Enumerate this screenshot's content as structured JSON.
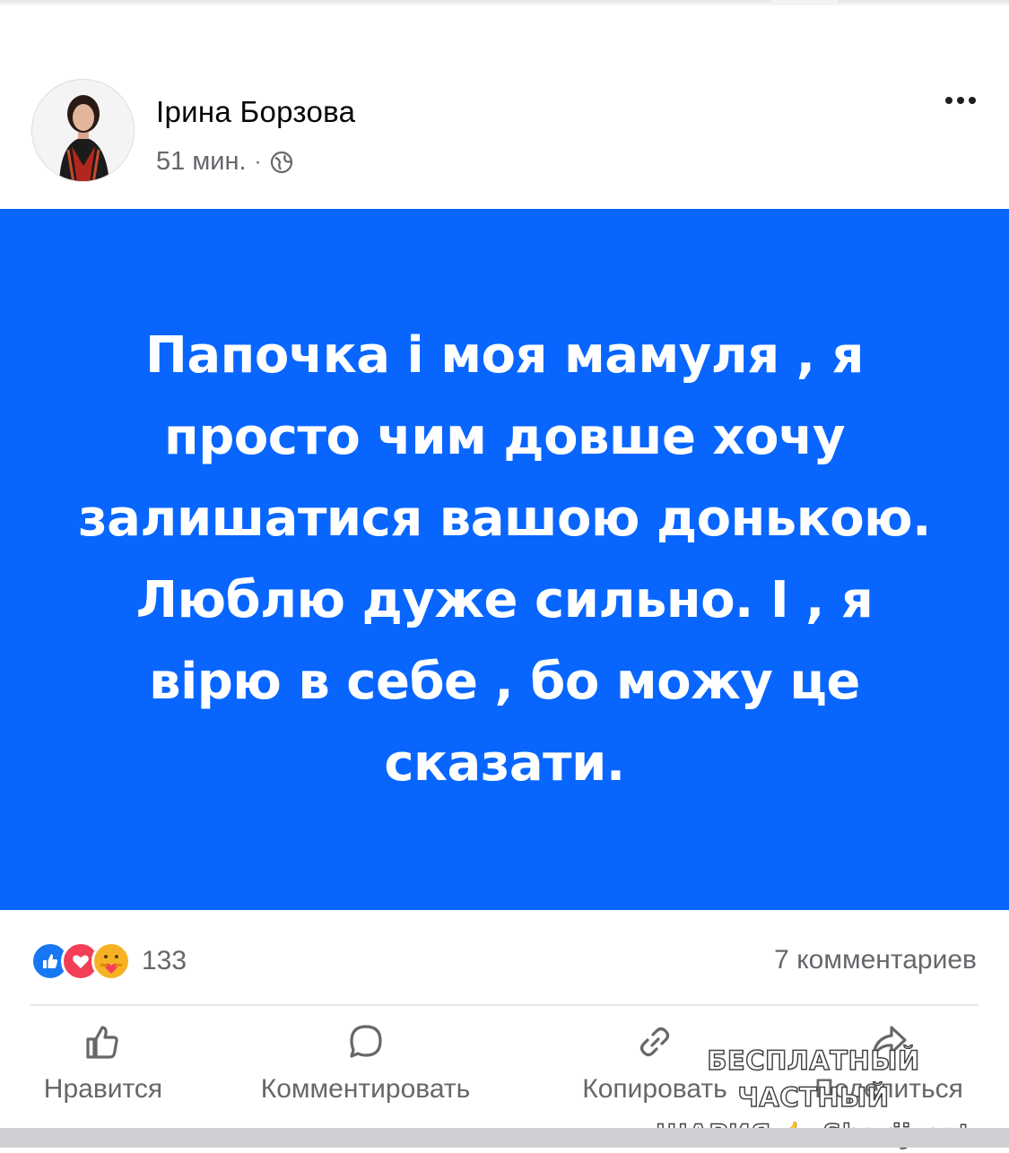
{
  "post": {
    "author": "Ірина Борзова",
    "time": "51 мин.",
    "separator": "·",
    "privacy_icon": "globe-icon",
    "text": "Папочка і моя мамуля , я просто чим довше хочу залишатися вашою донькою. Люблю дуже сильно. І , я вірю в себе , бо можу це сказати.",
    "background_color": "#0866ff"
  },
  "reactions": {
    "types": [
      "like",
      "love",
      "care"
    ],
    "count": "133",
    "comments": "7 комментариев"
  },
  "actions": {
    "like": "Нравится",
    "comment": "Комментировать",
    "copy": "Копировать",
    "share": "Поделиться"
  },
  "watermark": {
    "line1": "БЕСПЛАТНЫЙ ЧАСТНЫЙ",
    "line2": "ШАРИЯ 👉 Sharij.net"
  },
  "colors": {
    "accent": "#1877f2",
    "love": "#f33e58",
    "care": "#f7b125",
    "muted_text": "#65676b"
  }
}
